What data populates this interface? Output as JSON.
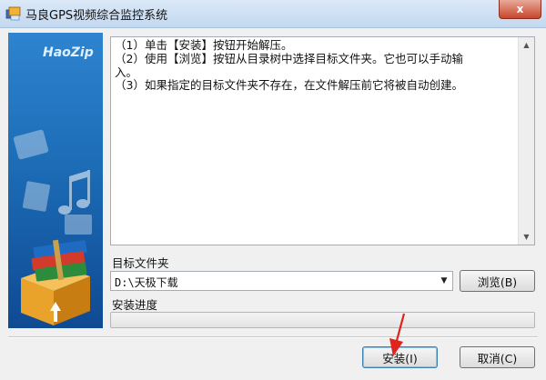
{
  "window": {
    "title": "马良GPS视频综合监控系统",
    "close_glyph": "x"
  },
  "sidebar": {
    "brand": "HaoZip"
  },
  "instructions": [
    "（1）单击【安装】按钮开始解压。",
    "（2）使用【浏览】按钮从目录树中选择目标文件夹。它也可以手动输",
    "入。",
    "（3）如果指定的目标文件夹不存在，在文件解压前它将被自动创建。"
  ],
  "target_folder": {
    "label": "目标文件夹",
    "value": "D:\\天极下载",
    "browse_label": "浏览(B)"
  },
  "progress": {
    "label": "安装进度",
    "fraction": 0
  },
  "actions": {
    "install_label": "安装(I)",
    "cancel_label": "取消(C)"
  },
  "colors": {
    "accent": "#1c6cb6",
    "close": "#c7462c",
    "highlight_arrow": "#e0231b"
  },
  "icons": [
    "app-icon",
    "close-icon",
    "scroll-up-icon",
    "scroll-down-icon",
    "dropdown-arrow-icon",
    "archive-box-icon",
    "music-note-icon"
  ]
}
